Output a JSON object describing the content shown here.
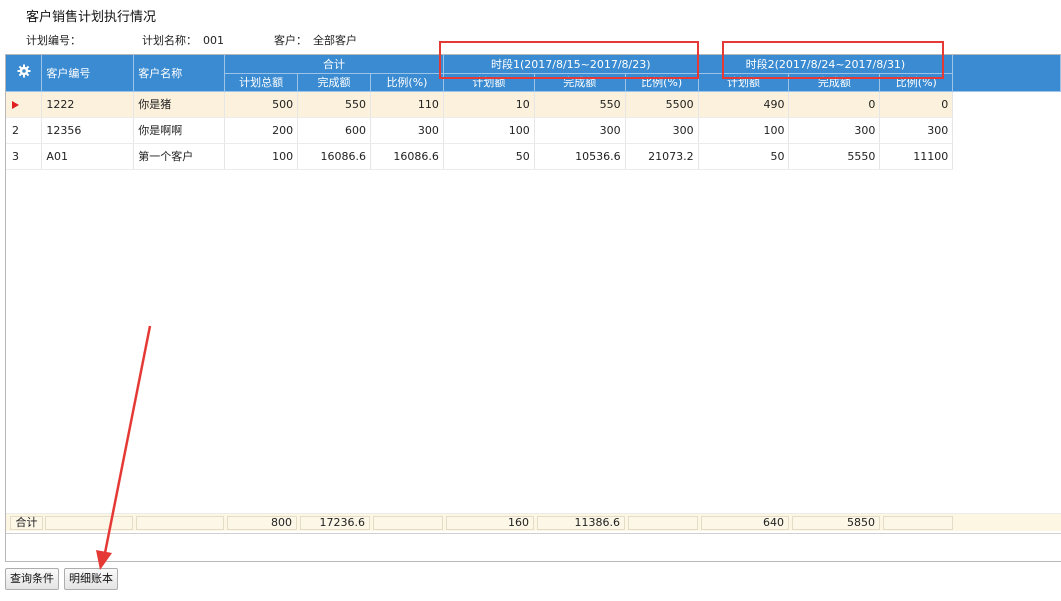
{
  "page": {
    "title": "客户销售计划执行情况",
    "plan_no_label": "计划编号：",
    "plan_no_value": "",
    "plan_name_label": "计划名称：",
    "plan_name_value": "001",
    "customer_label": "客户：",
    "customer_value": "全部客户"
  },
  "grid": {
    "headers": {
      "customer_code": "客户编号",
      "customer_name": "客户名称",
      "total_group": "合计",
      "period1_group": "时段1(2017/8/15~2017/8/23)",
      "period2_group": "时段2(2017/8/24~2017/8/31)",
      "total_plan": "计划总额",
      "total_done": "完成额",
      "total_ratio": "比例(%)",
      "p1_plan": "计划额",
      "p1_done": "完成额",
      "p1_ratio": "比例(%)",
      "p2_plan": "计划额",
      "p2_done": "完成额",
      "p2_ratio": "比例(%)"
    },
    "rows": [
      {
        "index": "",
        "code": "1222",
        "name": "你是猪",
        "total_plan": "500",
        "total_done": "550",
        "total_ratio": "110",
        "p1_plan": "10",
        "p1_done": "550",
        "p1_ratio": "5500",
        "p2_plan": "490",
        "p2_done": "0",
        "p2_ratio": "0"
      },
      {
        "index": "2",
        "code": "12356",
        "name": "你是啊啊",
        "total_plan": "200",
        "total_done": "600",
        "total_ratio": "300",
        "p1_plan": "100",
        "p1_done": "300",
        "p1_ratio": "300",
        "p2_plan": "100",
        "p2_done": "300",
        "p2_ratio": "300"
      },
      {
        "index": "3",
        "code": "A01",
        "name": "第一个客户",
        "total_plan": "100",
        "total_done": "16086.6",
        "total_ratio": "16086.6",
        "p1_plan": "50",
        "p1_done": "10536.6",
        "p1_ratio": "21073.2",
        "p2_plan": "50",
        "p2_done": "5550",
        "p2_ratio": "11100"
      }
    ],
    "summary": {
      "label": "合计",
      "total_plan": "800",
      "total_done": "17236.6",
      "p1_plan": "160",
      "p1_done": "11386.6",
      "p2_plan": "640",
      "p2_done": "5850"
    }
  },
  "buttons": {
    "query": "查询条件",
    "detail": "明细账本"
  },
  "icons": {
    "settings": "gear-icon",
    "row_indicator": "current-row-arrow-icon"
  },
  "colors": {
    "header_bg": "#3a8bd1",
    "selected_row": "#fbf1dc",
    "annotation_red": "#e53935"
  }
}
